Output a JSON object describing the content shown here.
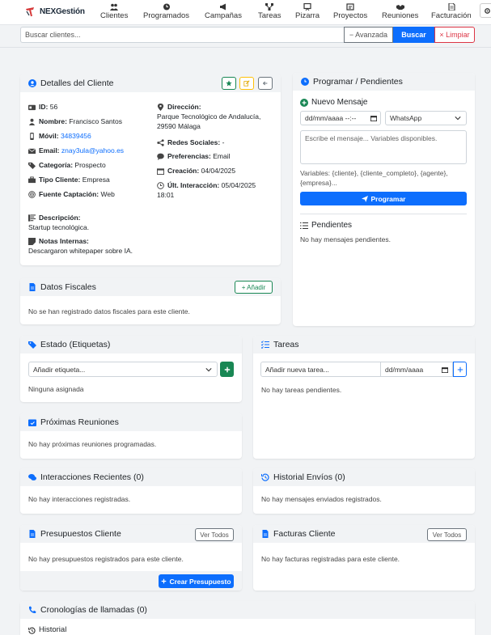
{
  "brand": {
    "name": "NEXGestión"
  },
  "nav": [
    {
      "label": "Clientes",
      "icon": "users-icon"
    },
    {
      "label": "Programados",
      "icon": "clock-icon"
    },
    {
      "label": "Campañas",
      "icon": "megaphone-icon"
    },
    {
      "label": "Tareas",
      "icon": "diagram-icon"
    },
    {
      "label": "Pizarra",
      "icon": "board-icon"
    },
    {
      "label": "Proyectos",
      "icon": "folder-icon"
    },
    {
      "label": "Reuniones",
      "icon": "handshake-icon"
    },
    {
      "label": "Facturación",
      "icon": "invoice-icon"
    }
  ],
  "search": {
    "placeholder": "Buscar clientes...",
    "advanced_label": "− Avanzada",
    "search_label": "Buscar",
    "clear_label": "× Limpiar"
  },
  "client_details": {
    "title": "Detalles del Cliente",
    "id_label": "ID:",
    "id": "56",
    "name_label": "Nombre:",
    "name": "Francisco Santos",
    "mobile_label": "Móvil:",
    "mobile": "34839456",
    "email_label": "Email:",
    "email": "znay3ula@yahoo.es",
    "category_label": "Categoría:",
    "category": "Prospecto",
    "type_label": "Tipo Cliente:",
    "type": "Empresa",
    "source_label": "Fuente Captación:",
    "source": "Web",
    "address_label": "Dirección:",
    "address_line1": "Parque Tecnológico de Andalucía,",
    "address_line2": "29590 Málaga",
    "social_label": "Redes Sociales:",
    "social": "-",
    "prefs_label": "Preferencias:",
    "prefs": "Email",
    "created_label": "Creación:",
    "created": "04/04/2025",
    "last_label": "Últ. Interacción:",
    "last_line1": "05/04/2025",
    "last_line2": "18:01",
    "desc_label": "Descripción:",
    "desc": "Startup tecnológica.",
    "notes_label": "Notas Internas:",
    "notes": "Descargaron whitepaper sobre IA."
  },
  "schedule": {
    "title": "Programar / Pendientes",
    "new_message": "Nuevo Mensaje",
    "date_placeholder": "dd/mm/aaaa --:--",
    "channel": "WhatsApp",
    "message_placeholder": "Escribe el mensaje... Variables disponibles.",
    "variables_line1": "Variables: {cliente}, {cliente_completo}, {agente},",
    "variables_line2": "{empresa}...",
    "button": "Programar",
    "pending_title": "Pendientes",
    "pending_empty": "No hay mensajes pendientes."
  },
  "fiscal": {
    "title": "Datos Fiscales",
    "add_label": "+ Añadir",
    "empty": "No se han registrado datos fiscales para este cliente."
  },
  "tags": {
    "title": "Estado (Etiquetas)",
    "placeholder": "Añadir etiqueta...",
    "empty": "Ninguna asignada"
  },
  "tasks": {
    "title": "Tareas",
    "placeholder": "Añadir nueva tarea...",
    "date_placeholder": "dd/mm/aaaa",
    "empty": "No hay tareas pendientes."
  },
  "meetings": {
    "title": "Próximas Reuniones",
    "empty": "No hay próximas reuniones programadas."
  },
  "interactions": {
    "title": "Interacciones Recientes (0)",
    "empty": "No hay interacciones registradas."
  },
  "history": {
    "title": "Historial Envíos (0)",
    "empty": "No hay mensajes enviados registrados."
  },
  "budgets": {
    "title": "Presupuestos Cliente",
    "view_all": "Ver Todos",
    "empty": "No hay presupuestos registrados para este cliente.",
    "create": "Crear Presupuesto"
  },
  "invoices": {
    "title": "Facturas Cliente",
    "view_all": "Ver Todos",
    "empty": "No hay facturas registradas para este cliente."
  },
  "calls": {
    "title": "Cronologías de llamadas (0)",
    "history": "Historial"
  },
  "colors": {
    "primary": "#0d6efd",
    "success": "#198754",
    "warning": "#ffc107",
    "danger": "#dc3545"
  }
}
